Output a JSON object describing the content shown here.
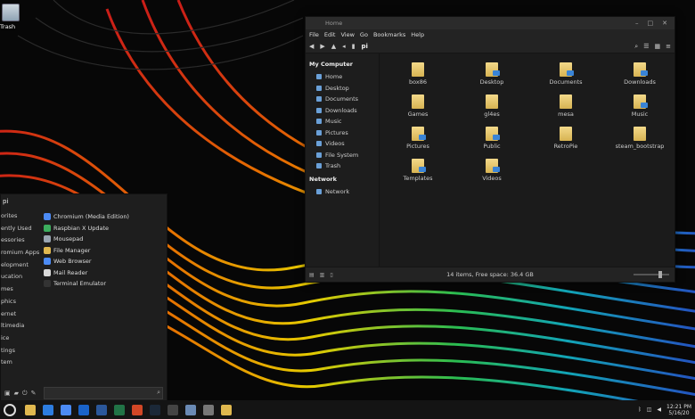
{
  "desktop": {
    "trash_label": "Trash"
  },
  "file_manager": {
    "title": "Home",
    "menu": [
      "File",
      "Edit",
      "View",
      "Go",
      "Bookmarks",
      "Help"
    ],
    "location": "pi",
    "window_controls": [
      "–",
      "□",
      "✕"
    ],
    "sidebar": {
      "my_computer": "My Computer",
      "my_computer_items": [
        "Home",
        "Desktop",
        "Documents",
        "Downloads",
        "Music",
        "Pictures",
        "Videos",
        "File System",
        "Trash"
      ],
      "network": "Network",
      "network_items": [
        "Network"
      ]
    },
    "files": [
      "box86",
      "Desktop",
      "Documents",
      "Downloads",
      "Games",
      "gl4es",
      "mesa",
      "Music",
      "Pictures",
      "Public",
      "RetroPie",
      "steam_bootstrap",
      "Templates",
      "Videos"
    ],
    "status": "14 items, Free space: 36.4 GB"
  },
  "start_menu": {
    "user": "pi",
    "categories": [
      "orites",
      "ently Used",
      "essories",
      "romium Apps",
      "elopment",
      "ucation",
      "mes",
      "phics",
      "ernet",
      "ltimedia",
      "ice",
      "tings",
      "tem"
    ],
    "apps": [
      {
        "label": "Chromium (Media Edition)",
        "color": "#4c8bf5"
      },
      {
        "label": "Raspbian X Update",
        "color": "#3cae5e"
      },
      {
        "label": "Mousepad",
        "color": "#9aa6b2"
      },
      {
        "label": "File Manager",
        "color": "#e0b84f"
      },
      {
        "label": "Web Browser",
        "color": "#4c8bf5"
      },
      {
        "label": "Mail Reader",
        "color": "#d9d9d9"
      },
      {
        "label": "Terminal Emulator",
        "color": "#333333"
      }
    ]
  },
  "taskbar": {
    "apps": [
      {
        "name": "folder",
        "color": "#e0b84f"
      },
      {
        "name": "store",
        "color": "#2d7de0"
      },
      {
        "name": "chrome",
        "color": "#4c8bf5"
      },
      {
        "name": "outlook",
        "color": "#1a63c9"
      },
      {
        "name": "word",
        "color": "#2b579a"
      },
      {
        "name": "excel",
        "color": "#217346"
      },
      {
        "name": "powerpoint",
        "color": "#d24726"
      },
      {
        "name": "steam",
        "color": "#1b2838"
      },
      {
        "name": "terminal",
        "color": "#444444"
      },
      {
        "name": "files",
        "color": "#6a8ab5"
      },
      {
        "name": "calculator",
        "color": "#777777"
      },
      {
        "name": "explorer",
        "color": "#e0b84f"
      }
    ],
    "time": "12:21 PM",
    "date": "5/16/20"
  }
}
